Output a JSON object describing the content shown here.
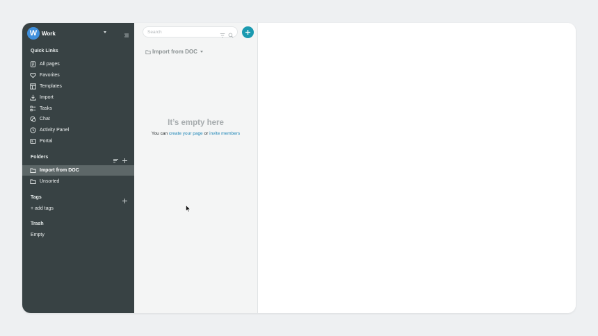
{
  "workspace": {
    "avatar_letter": "W",
    "name": "Work"
  },
  "sidebar": {
    "quick_links_label": "Quick Links",
    "quick_links": [
      {
        "label": "All pages",
        "icon": "document-icon"
      },
      {
        "label": "Favorites",
        "icon": "heart-icon"
      },
      {
        "label": "Templates",
        "icon": "templates-icon"
      },
      {
        "label": "Import",
        "icon": "download-icon"
      },
      {
        "label": "Tasks",
        "icon": "tasks-icon"
      },
      {
        "label": "Chat",
        "icon": "chat-icon"
      },
      {
        "label": "Activity Panel",
        "icon": "clock-icon"
      },
      {
        "label": "Portal",
        "icon": "portal-icon"
      }
    ],
    "folders_label": "Folders",
    "folders": [
      {
        "label": "Import from DOC",
        "active": true
      },
      {
        "label": "Unsorted",
        "active": false
      }
    ],
    "tags_label": "Tags",
    "add_tags": "+ add tags",
    "trash_label": "Trash",
    "trash_state": "Empty"
  },
  "middle": {
    "search_placeholder": "Search",
    "folder_title": "Import from DOC",
    "empty_title": "It’s empty here",
    "empty_prefix": "You can ",
    "create_link": "create your page",
    "empty_or": " or ",
    "invite_link": "invite members"
  },
  "colors": {
    "sidebar_bg": "#384244",
    "active_item_bg": "#5d6768",
    "accent": "#1b9ab0",
    "link": "#2288b8",
    "avatar": "#3f8fdc"
  }
}
